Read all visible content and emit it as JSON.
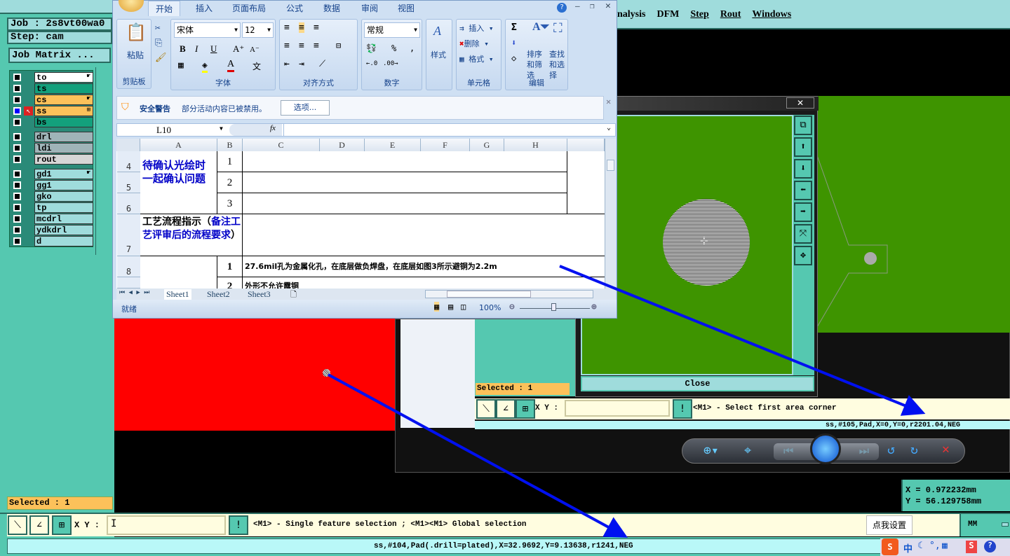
{
  "left_panel": {
    "job_label": "Job : 2s8vt00wa0",
    "step_label": "Step: cam",
    "job_matrix_button": "Job Matrix ...",
    "layers": [
      {
        "name": "to",
        "color": "#ffffff",
        "hand": true
      },
      {
        "name": "ts",
        "color": "#13a07c",
        "hand": false
      },
      {
        "name": "cs",
        "color": "#fcc15a",
        "hand": true
      },
      {
        "name": "ss",
        "color": "#fcc15a",
        "hand": false,
        "selected": true
      },
      {
        "name": "bs",
        "color": "#13a07c",
        "hand": false
      },
      {
        "name": "drl",
        "color": "#9fb4b8",
        "hand": false
      },
      {
        "name": "ldi",
        "color": "#9fb4b8",
        "hand": false
      },
      {
        "name": "rout",
        "color": "#d6d6d6",
        "hand": false
      },
      {
        "name": "gd1",
        "color": "#9fdcdc",
        "hand": true
      },
      {
        "name": "gg1",
        "color": "#9fdcdc",
        "hand": false
      },
      {
        "name": "gko",
        "color": "#9fdcdc",
        "hand": false
      },
      {
        "name": "tp",
        "color": "#9fdcdc",
        "hand": false
      },
      {
        "name": "mcdrl",
        "color": "#9fdcdc",
        "hand": false
      },
      {
        "name": "ydkdrl",
        "color": "#9fdcdc",
        "hand": false
      },
      {
        "name": "d",
        "color": "#9fdcdc",
        "hand": false
      }
    ],
    "selected_label": "Selected : 1"
  },
  "menu": [
    "nalysis",
    "DFM",
    "Step",
    "Rout",
    "Windows"
  ],
  "excel": {
    "tabs": [
      "开始",
      "插入",
      "页面布局",
      "公式",
      "数据",
      "审阅",
      "视图"
    ],
    "font_name": "宋体",
    "font_size": "12",
    "number_format": "常规",
    "paste": "粘贴",
    "style": "样式",
    "insert": "插入",
    "delete": "删除",
    "format": "格式",
    "sort_filter": "排序和筛选",
    "find_select": "查找和选择",
    "groups": [
      "剪贴板",
      "字体",
      "对齐方式",
      "数字",
      "单元格",
      "编辑"
    ],
    "security_title": "安全警告",
    "security_msg": "部分活动内容已被禁用。",
    "options_button": "选项...",
    "name_box": "L10",
    "fx": "fx",
    "columns": [
      "A",
      "B",
      "C",
      "D",
      "E",
      "F",
      "G",
      "H"
    ],
    "rows": [
      "4",
      "5",
      "6",
      "7",
      "8"
    ],
    "cell_a4": "待确认光绘时一起确认问题",
    "b_values": [
      "1",
      "2",
      "3"
    ],
    "cell_a7_black": "工艺流程指示（",
    "cell_a7_blue": "备注工艺评审后的流程要求",
    "cell_a7_end": "）",
    "row8_b": "1",
    "row8_c": "27.6mil孔为金属化孔，在底层做负焊盘，在底层如图3所示避铜为2.2m",
    "row9_b": "2",
    "row9_c": "外形不允许露铜",
    "sheets": [
      "Sheet1",
      "Sheet2",
      "Sheet3"
    ],
    "status": "就绪",
    "zoom": "100%"
  },
  "magnifier": {
    "title": "- 1",
    "close_button": "Close"
  },
  "viewer_panel": {
    "selected_label": "Selected : 1",
    "xy_label": "X Y :",
    "prompt": "<M1> - Select first area corner",
    "status": "ss,#105,Pad,X=0,Y=0,r2201.04,NEG"
  },
  "coords": {
    "x": "X = 0.972232mm",
    "y": "Y = 56.129758mm"
  },
  "bottom": {
    "xy_label": "X Y :",
    "prompt": "<M1> - Single feature selection ; <M1><M1> Global selection",
    "tooltip": "点我设置",
    "units": "MM",
    "status": "ss,#104,Pad(.drill=plated),X=32.9692,Y=9.13638,r1241,NEG",
    "ime": "中"
  }
}
